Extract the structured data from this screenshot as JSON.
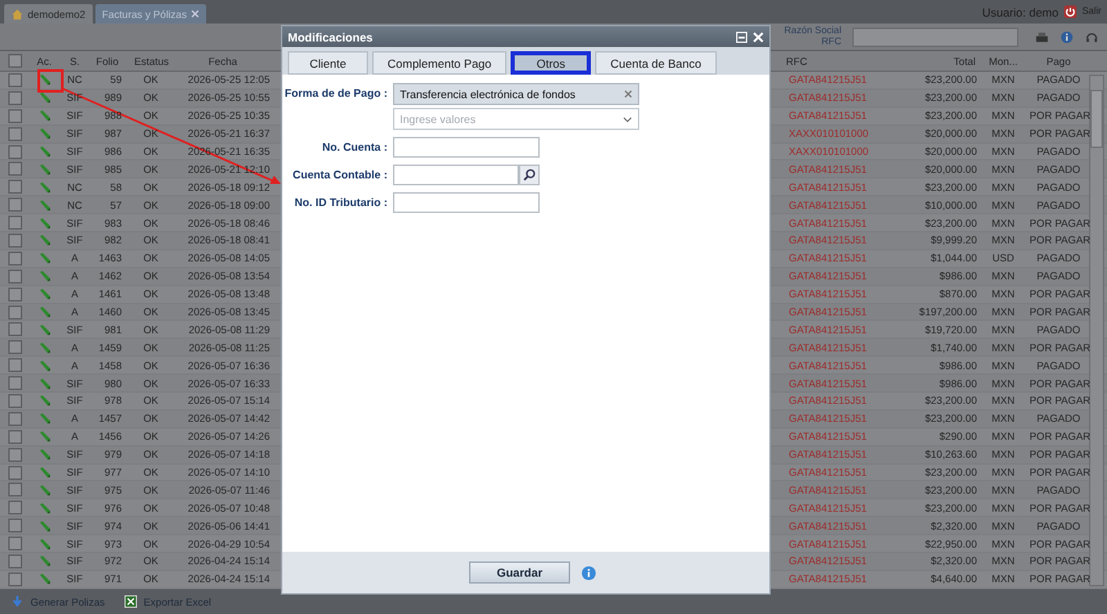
{
  "top_tabs": [
    {
      "label": "demodemo2",
      "selected": false,
      "closable": false
    },
    {
      "label": "Facturas y Pólizas",
      "selected": true,
      "closable": true
    }
  ],
  "user": {
    "label": "Usuario: demo",
    "logout": "Salir"
  },
  "filter": {
    "label_1": "Razón Social",
    "label_2": "RFC"
  },
  "table": {
    "select_all": false,
    "columns_left": [
      "Ac.",
      "S.",
      "Folio",
      "Estatus",
      "Fecha"
    ],
    "columns_right": [
      "RFC",
      "Total",
      "Mon...",
      "Pago"
    ],
    "rows": [
      {
        "checked": false,
        "serie": "NC",
        "folio": "59",
        "estatus": "OK",
        "fecha": "2026-05-25 12:05",
        "rfc": "GATA841215J51",
        "total": "$23,200.00",
        "moneda": "MXN",
        "pago": "PAGADO"
      },
      {
        "checked": false,
        "serie": "SIF",
        "folio": "989",
        "estatus": "OK",
        "fecha": "2026-05-25 10:55",
        "rfc": "GATA841215J51",
        "total": "$23,200.00",
        "moneda": "MXN",
        "pago": "PAGADO"
      },
      {
        "checked": false,
        "serie": "SIF",
        "folio": "988",
        "estatus": "OK",
        "fecha": "2026-05-25 10:35",
        "rfc": "GATA841215J51",
        "total": "$23,200.00",
        "moneda": "MXN",
        "pago": "POR PAGAR"
      },
      {
        "checked": false,
        "serie": "SIF",
        "folio": "987",
        "estatus": "OK",
        "fecha": "2026-05-21 16:37",
        "rfc": "XAXX010101000",
        "total": "$20,000.00",
        "moneda": "MXN",
        "pago": "POR PAGAR"
      },
      {
        "checked": false,
        "serie": "SIF",
        "folio": "986",
        "estatus": "OK",
        "fecha": "2026-05-21 16:35",
        "rfc": "XAXX010101000",
        "total": "$20,000.00",
        "moneda": "MXN",
        "pago": "PAGADO"
      },
      {
        "checked": false,
        "serie": "SIF",
        "folio": "985",
        "estatus": "OK",
        "fecha": "2026-05-21 12:10",
        "rfc": "GATA841215J51",
        "total": "$20,000.00",
        "moneda": "MXN",
        "pago": "PAGADO"
      },
      {
        "checked": false,
        "serie": "NC",
        "folio": "58",
        "estatus": "OK",
        "fecha": "2026-05-18 09:12",
        "rfc": "GATA841215J51",
        "total": "$23,200.00",
        "moneda": "MXN",
        "pago": "PAGADO"
      },
      {
        "checked": false,
        "serie": "NC",
        "folio": "57",
        "estatus": "OK",
        "fecha": "2026-05-18 09:00",
        "rfc": "GATA841215J51",
        "total": "$10,000.00",
        "moneda": "MXN",
        "pago": "PAGADO"
      },
      {
        "checked": false,
        "serie": "SIF",
        "folio": "983",
        "estatus": "OK",
        "fecha": "2026-05-18 08:46",
        "rfc": "GATA841215J51",
        "total": "$23,200.00",
        "moneda": "MXN",
        "pago": "POR PAGAR"
      },
      {
        "checked": false,
        "serie": "SIF",
        "folio": "982",
        "estatus": "OK",
        "fecha": "2026-05-18 08:41",
        "rfc": "GATA841215J51",
        "total": "$9,999.20",
        "moneda": "MXN",
        "pago": "POR PAGAR"
      },
      {
        "checked": false,
        "serie": "A",
        "folio": "1463",
        "estatus": "OK",
        "fecha": "2026-05-08 14:05",
        "rfc": "GATA841215J51",
        "total": "$1,044.00",
        "moneda": "USD",
        "pago": "PAGADO"
      },
      {
        "checked": false,
        "serie": "A",
        "folio": "1462",
        "estatus": "OK",
        "fecha": "2026-05-08 13:54",
        "rfc": "GATA841215J51",
        "total": "$986.00",
        "moneda": "MXN",
        "pago": "PAGADO"
      },
      {
        "checked": false,
        "serie": "A",
        "folio": "1461",
        "estatus": "OK",
        "fecha": "2026-05-08 13:48",
        "rfc": "GATA841215J51",
        "total": "$870.00",
        "moneda": "MXN",
        "pago": "POR PAGAR"
      },
      {
        "checked": false,
        "serie": "A",
        "folio": "1460",
        "estatus": "OK",
        "fecha": "2026-05-08 13:45",
        "rfc": "GATA841215J51",
        "total": "$197,200.00",
        "moneda": "MXN",
        "pago": "POR PAGAR"
      },
      {
        "checked": false,
        "serie": "SIF",
        "folio": "981",
        "estatus": "OK",
        "fecha": "2026-05-08 11:29",
        "rfc": "GATA841215J51",
        "total": "$19,720.00",
        "moneda": "MXN",
        "pago": "PAGADO"
      },
      {
        "checked": false,
        "serie": "A",
        "folio": "1459",
        "estatus": "OK",
        "fecha": "2026-05-08 11:25",
        "rfc": "GATA841215J51",
        "total": "$1,740.00",
        "moneda": "MXN",
        "pago": "POR PAGAR"
      },
      {
        "checked": false,
        "serie": "A",
        "folio": "1458",
        "estatus": "OK",
        "fecha": "2026-05-07 16:36",
        "rfc": "GATA841215J51",
        "total": "$986.00",
        "moneda": "MXN",
        "pago": "PAGADO"
      },
      {
        "checked": false,
        "serie": "SIF",
        "folio": "980",
        "estatus": "OK",
        "fecha": "2026-05-07 16:33",
        "rfc": "GATA841215J51",
        "total": "$986.00",
        "moneda": "MXN",
        "pago": "POR PAGAR"
      },
      {
        "checked": false,
        "serie": "SIF",
        "folio": "978",
        "estatus": "OK",
        "fecha": "2026-05-07 15:14",
        "rfc": "GATA841215J51",
        "total": "$23,200.00",
        "moneda": "MXN",
        "pago": "POR PAGAR"
      },
      {
        "checked": false,
        "serie": "A",
        "folio": "1457",
        "estatus": "OK",
        "fecha": "2026-05-07 14:42",
        "rfc": "GATA841215J51",
        "total": "$23,200.00",
        "moneda": "MXN",
        "pago": "PAGADO"
      },
      {
        "checked": false,
        "serie": "A",
        "folio": "1456",
        "estatus": "OK",
        "fecha": "2026-05-07 14:26",
        "rfc": "GATA841215J51",
        "total": "$290.00",
        "moneda": "MXN",
        "pago": "POR PAGAR"
      },
      {
        "checked": false,
        "serie": "SIF",
        "folio": "979",
        "estatus": "OK",
        "fecha": "2026-05-07 14:18",
        "rfc": "GATA841215J51",
        "total": "$10,263.60",
        "moneda": "MXN",
        "pago": "POR PAGAR"
      },
      {
        "checked": false,
        "serie": "SIF",
        "folio": "977",
        "estatus": "OK",
        "fecha": "2026-05-07 14:10",
        "rfc": "GATA841215J51",
        "total": "$23,200.00",
        "moneda": "MXN",
        "pago": "POR PAGAR"
      },
      {
        "checked": false,
        "serie": "SIF",
        "folio": "975",
        "estatus": "OK",
        "fecha": "2026-05-07 11:46",
        "rfc": "GATA841215J51",
        "total": "$23,200.00",
        "moneda": "MXN",
        "pago": "PAGADO"
      },
      {
        "checked": false,
        "serie": "SIF",
        "folio": "976",
        "estatus": "OK",
        "fecha": "2026-05-07 10:48",
        "rfc": "GATA841215J51",
        "total": "$23,200.00",
        "moneda": "MXN",
        "pago": "POR PAGAR"
      },
      {
        "checked": false,
        "serie": "SIF",
        "folio": "974",
        "estatus": "OK",
        "fecha": "2026-05-06 14:41",
        "rfc": "GATA841215J51",
        "total": "$2,320.00",
        "moneda": "MXN",
        "pago": "PAGADO"
      },
      {
        "checked": false,
        "serie": "SIF",
        "folio": "973",
        "estatus": "OK",
        "fecha": "2026-04-29 10:54",
        "rfc": "GATA841215J51",
        "total": "$22,950.00",
        "moneda": "MXN",
        "pago": "POR PAGAR"
      },
      {
        "checked": false,
        "serie": "SIF",
        "folio": "972",
        "estatus": "OK",
        "fecha": "2026-04-24 15:14",
        "rfc": "GATA841215J51",
        "total": "$2,320.00",
        "moneda": "MXN",
        "pago": "POR PAGAR"
      },
      {
        "checked": false,
        "serie": "SIF",
        "folio": "971",
        "estatus": "OK",
        "fecha": "2026-04-24 15:14",
        "rfc": "GATA841215J51",
        "total": "$4,640.00",
        "moneda": "MXN",
        "pago": "POR PAGAR"
      }
    ]
  },
  "modal": {
    "title": "Modificaciones",
    "tabs": [
      {
        "label": "Cliente",
        "selected": false
      },
      {
        "label": "Complemento Pago",
        "selected": false
      },
      {
        "label": "Otros",
        "selected": true
      },
      {
        "label": "Cuenta de Banco",
        "selected": false
      }
    ],
    "fields": [
      {
        "kind": "tags",
        "label": "Forma de de Pago :",
        "chips": [
          "Transferencia electrónica de fondos"
        ],
        "placeholder": "Ingrese valores"
      },
      {
        "kind": "text",
        "label": "No. Cuenta :"
      },
      {
        "kind": "search",
        "label": "Cuenta Contable :"
      },
      {
        "kind": "text",
        "label": "No. ID Tributario :"
      }
    ],
    "save": "Guardar"
  },
  "bottom_bar": {
    "buttons": [
      "Generar Polizas",
      "Exportar Excel"
    ]
  }
}
